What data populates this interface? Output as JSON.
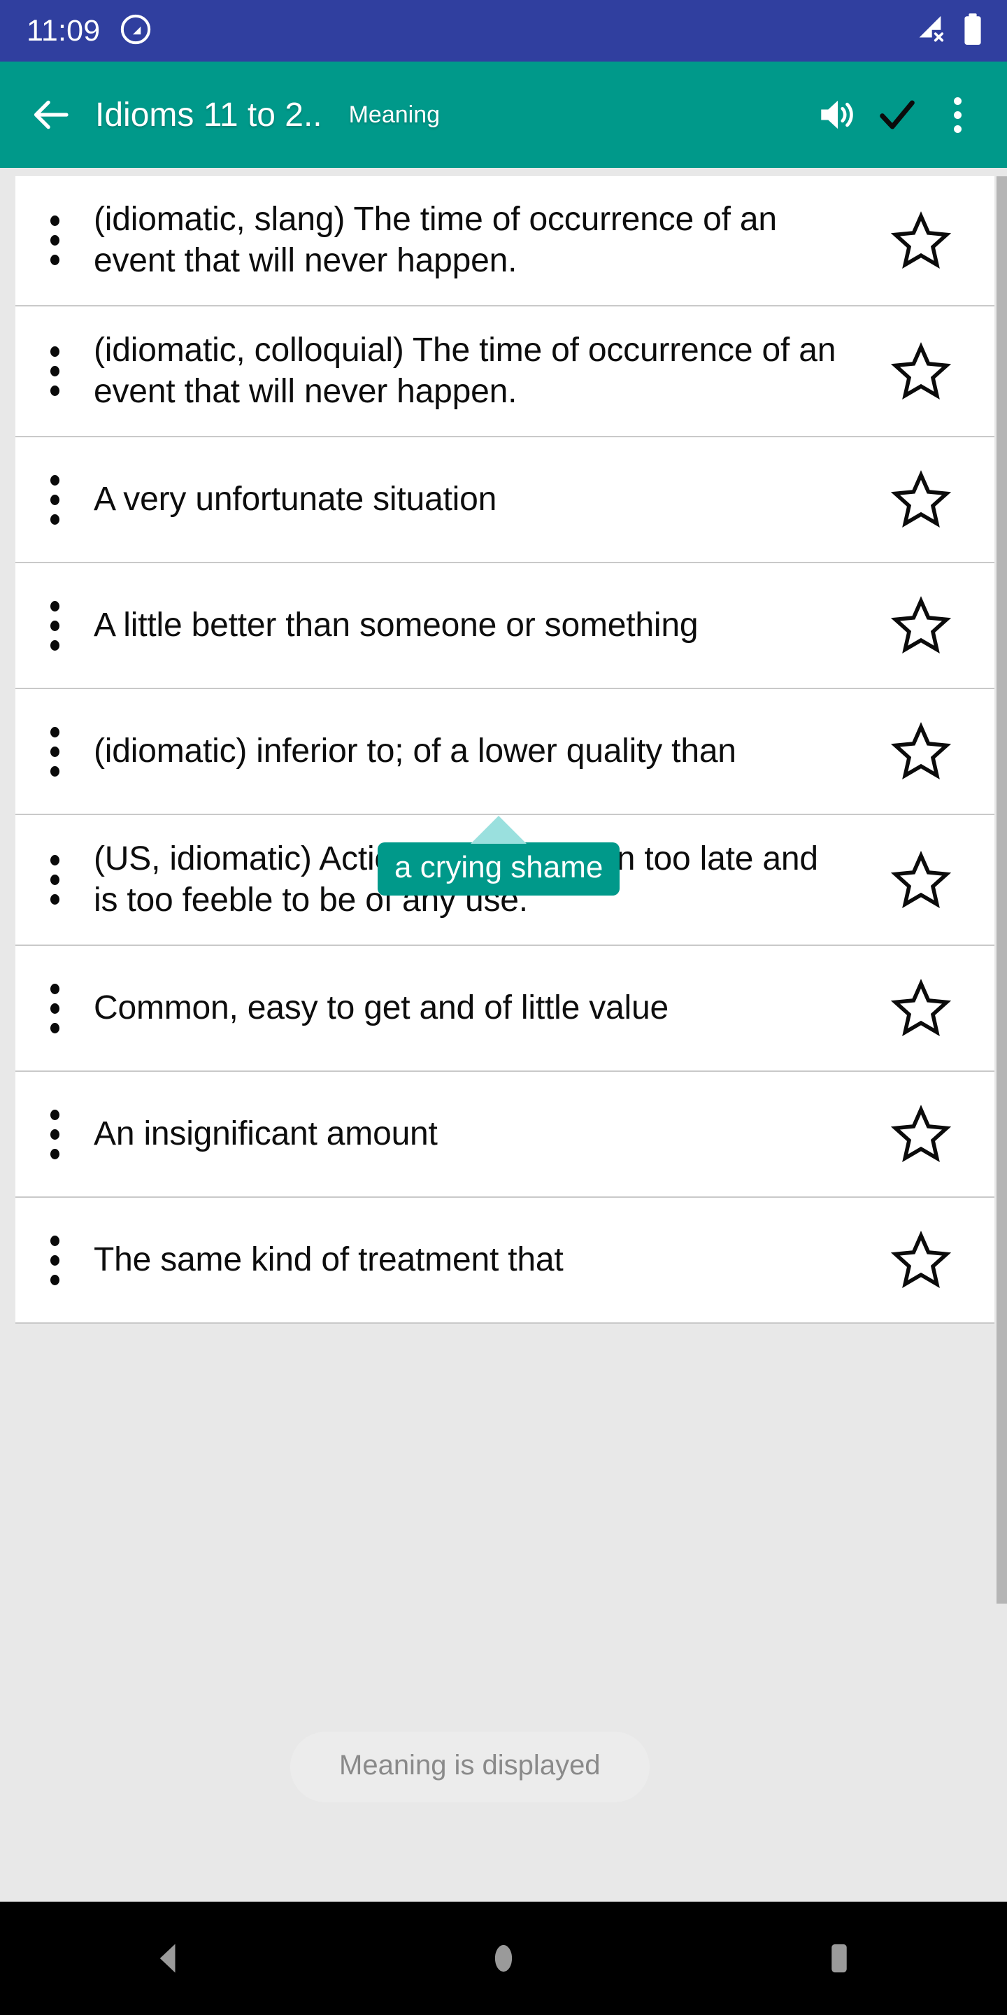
{
  "status_bar": {
    "time": "11:09",
    "icons": [
      "do-not-disturb-icon",
      "signal-no-service-icon",
      "battery-full-icon"
    ],
    "background": "#303f9f"
  },
  "app_bar": {
    "background": "#00998a",
    "back_icon": "back-arrow-icon",
    "title": "Idioms 11 to 2..",
    "mode_label": "Meaning",
    "speaker_icon": "speaker-volume-icon",
    "check_icon": "checkmark-icon",
    "overflow_icon": "more-vertical-icon"
  },
  "list": {
    "rows": [
      {
        "text": "(idiomatic, slang) The time of occurrence of an event that will never happen.",
        "starred": false
      },
      {
        "text": "(idiomatic, colloquial) The time of occurrence of an event that will never happen.",
        "starred": false
      },
      {
        "text": "A very unfortunate situation",
        "starred": false
      },
      {
        "text": "A little better than someone or something",
        "starred": false
      },
      {
        "text": "(idiomatic) inferior to; of a lower quality than",
        "starred": false
      },
      {
        "text": "(US, idiomatic) Action that was taken too late and is too feeble to be of any use.",
        "starred": false
      },
      {
        "text": "Common, easy to get and of little value",
        "starred": false
      },
      {
        "text": "An insignificant amount",
        "starred": false
      },
      {
        "text": "The same kind of treatment that",
        "starred": false
      }
    ]
  },
  "tooltip": {
    "text": "a crying shame",
    "background": "#00998a",
    "arrow_color": "#9ae0de"
  },
  "toast": {
    "text": "Meaning is displayed"
  },
  "nav_bar": {
    "back_label": "back-triangle-icon",
    "home_label": "home-circle-icon",
    "recents_label": "recents-square-icon"
  }
}
